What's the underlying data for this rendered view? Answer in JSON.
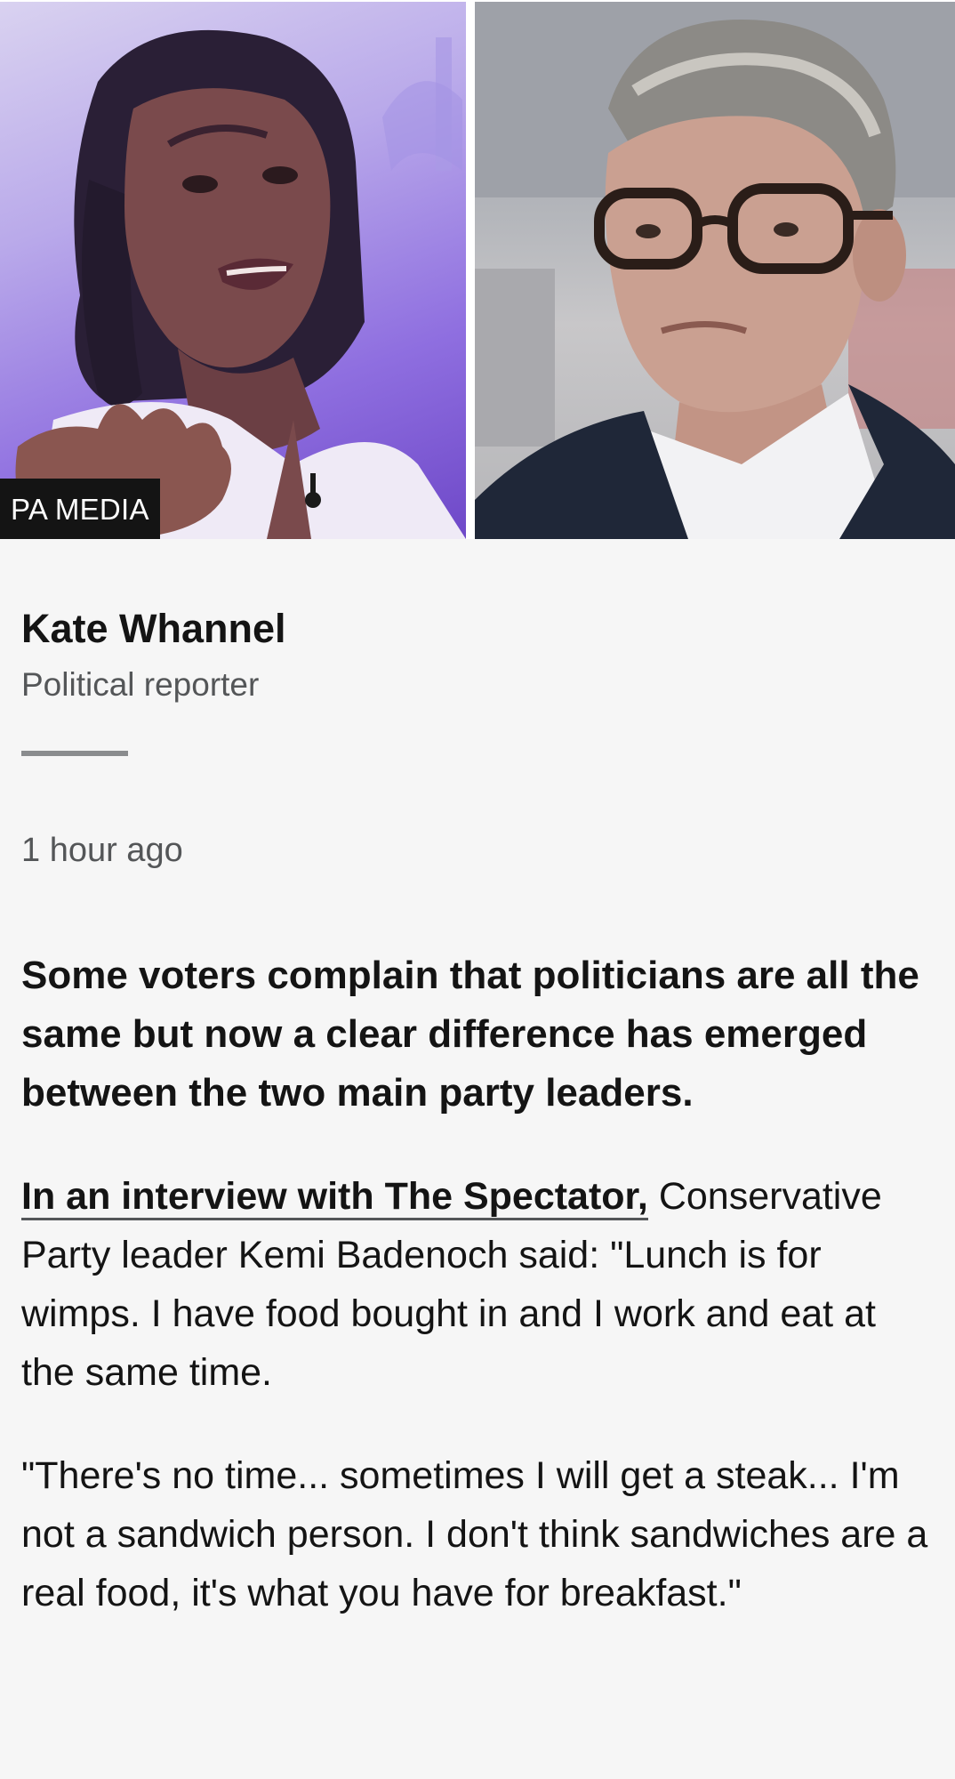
{
  "hero": {
    "left_photo_icon": "photo-woman-speaking",
    "right_photo_icon": "photo-man-glasses",
    "credit": "PA MEDIA"
  },
  "byline": {
    "author_name": "Kate Whannel",
    "author_role": "Political reporter"
  },
  "timestamp": "1 hour ago",
  "article": {
    "lead": "Some voters complain that politicians are all the same but now a clear difference has emerged between the two main party leaders.",
    "para1_link": "In an interview with The Spectator,",
    "para1_text": " Conservative Party leader Kemi Badenoch said: \"Lunch is for wimps. I have food bought in and I work and eat at the same time.",
    "para2": "\"There's no time... sometimes I will get a steak... I'm not a sandwich person. I don't think sandwiches are a real food, it's what you have for breakfast.\""
  },
  "colors": {
    "background": "#f6f6f6",
    "text": "#141414",
    "muted": "#545658",
    "credit_bg": "#141414"
  }
}
